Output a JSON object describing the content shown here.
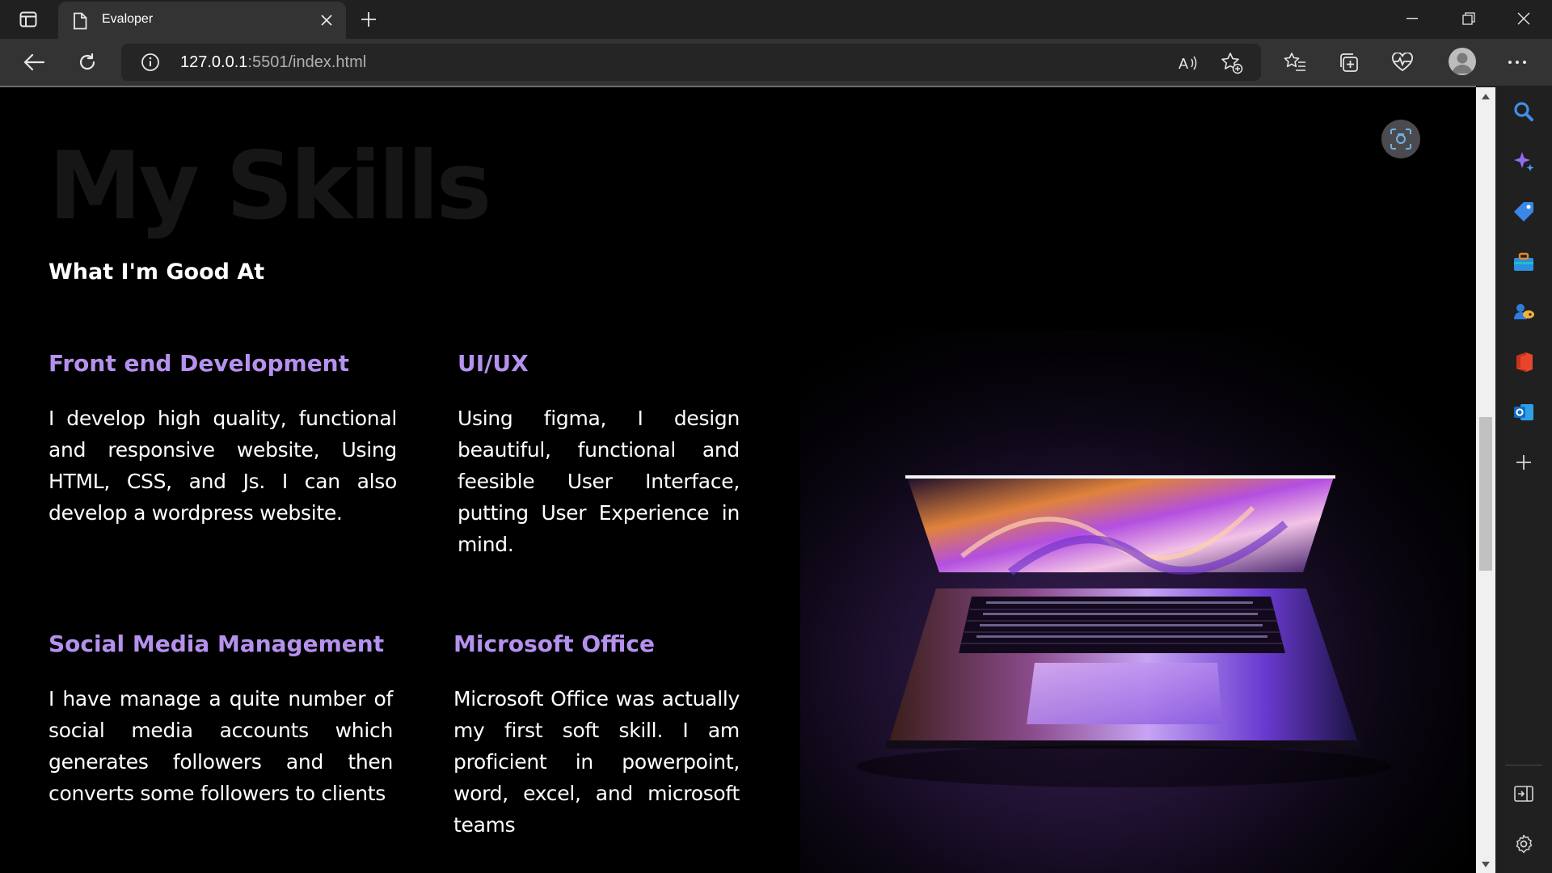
{
  "browser": {
    "tab": {
      "title": "Evaloper"
    },
    "address": {
      "host": "127.0.0.1",
      "rest": ":5501/index.html"
    }
  },
  "page": {
    "background_heading": "My Skills",
    "subheading": "What I'm Good At",
    "skills": [
      {
        "title": "Front end Development",
        "description": "I develop high quality, functional and responsive website, Using HTML, CSS, and Js. I can also develop a wordpress website."
      },
      {
        "title": "UI/UX",
        "description": "Using figma, I design beautiful, functional and feesible User Interface, putting User Experience in mind."
      },
      {
        "title": "Social Media Management",
        "description": "I have manage a quite number of social media accounts which generates followers and then converts some followers to clients"
      },
      {
        "title": "Microsoft Office",
        "description": "Microsoft Office was actually my first soft skill. I am proficient in powerpoint, word, excel, and microsoft teams"
      }
    ]
  },
  "colors": {
    "accent": "#b591ee",
    "page_background": "#000000",
    "browser_chrome": "#202020",
    "toolbar": "#333333"
  },
  "icons": {
    "toolbar": [
      "back-icon",
      "refresh-icon",
      "info-icon",
      "read-aloud-icon",
      "add-favorite-icon",
      "favorites-icon",
      "collections-icon",
      "browser-essentials-icon",
      "profile-icon",
      "more-icon"
    ],
    "sidebar": [
      "search-icon",
      "copilot-icon",
      "shopping-icon",
      "tools-icon",
      "games-icon",
      "office-icon",
      "outlook-icon",
      "add-icon",
      "hide-sidebar-icon",
      "settings-icon"
    ]
  }
}
